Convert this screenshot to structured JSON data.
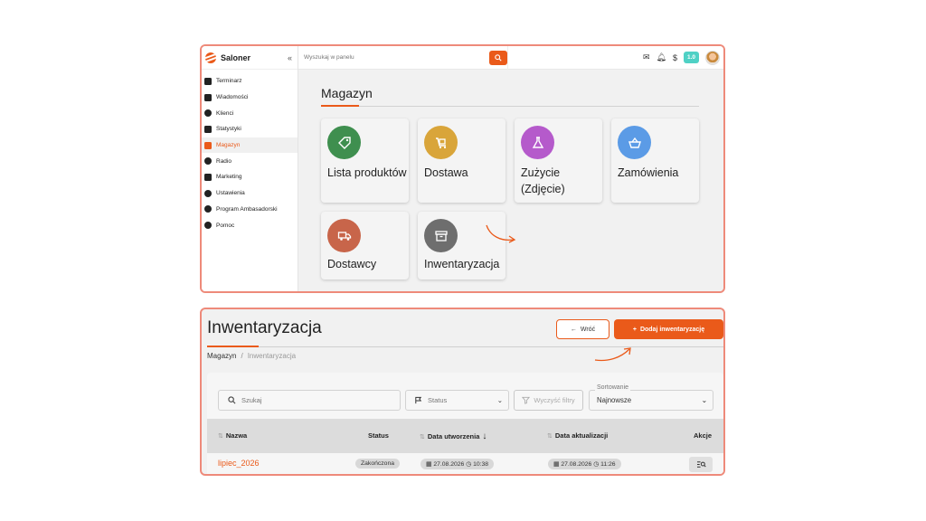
{
  "colors": {
    "accent": "#ea5a1a",
    "panel_border": "#ee8a7a",
    "badge": "#4fd1c5"
  },
  "app": {
    "name": "Saloner",
    "version": "1.0"
  },
  "sidebar": {
    "items": [
      {
        "label": "Terminarz",
        "icon": "calendar-icon"
      },
      {
        "label": "Wiadomości",
        "icon": "mail-icon"
      },
      {
        "label": "Klienci",
        "icon": "users-icon"
      },
      {
        "label": "Statystyki",
        "icon": "bar-chart-icon"
      },
      {
        "label": "Magazyn",
        "icon": "bag-icon",
        "active": true
      },
      {
        "label": "Radio",
        "icon": "music-icon"
      },
      {
        "label": "Marketing",
        "icon": "megaphone-icon"
      },
      {
        "label": "Ustawienia",
        "icon": "gear-icon"
      },
      {
        "label": "Program Ambasadorski",
        "icon": "smile-icon"
      },
      {
        "label": "Pomoc",
        "icon": "help-icon"
      }
    ]
  },
  "topbar": {
    "search_placeholder": "Wyszukaj w panelu"
  },
  "magazyn": {
    "title": "Magazyn",
    "cards": [
      {
        "label": "Lista produktów",
        "color": "#3f8f4f",
        "icon": "tag-icon"
      },
      {
        "label": "Dostawa",
        "color": "#d9a53a",
        "icon": "cart-icon"
      },
      {
        "label": "Zużycie (Zdjęcie)",
        "color": "#b55acb",
        "icon": "flask-icon"
      },
      {
        "label": "Zamówienia",
        "color": "#5b9be6",
        "icon": "basket-icon"
      },
      {
        "label": "Dostawcy",
        "color": "#c8654a",
        "icon": "truck-icon"
      },
      {
        "label": "Inwentaryzacja",
        "color": "#6e6e6e",
        "icon": "archive-icon"
      }
    ]
  },
  "inwentaryzacja": {
    "title": "Inwentaryzacja",
    "back_label": "Wróć",
    "add_label": "Dodaj inwentaryzację",
    "breadcrumb": {
      "parent": "Magazyn",
      "separator": "/",
      "current": "Inwentaryzacja"
    },
    "filters": {
      "search_placeholder": "Szukaj",
      "status_label": "Status",
      "clear_label": "Wyczyść filtry",
      "sort_legend": "Sortowanie",
      "sort_value": "Najnowsze"
    },
    "table": {
      "columns": [
        "Nazwa",
        "Status",
        "Data utworzenia",
        "Data aktualizacji",
        "Akcje"
      ],
      "rows": [
        {
          "name": "lipiec_2026",
          "status": "Zakończona",
          "created": "27.08.2026",
          "created_time": "10:38",
          "updated": "27.08.2026",
          "updated_time": "11:26"
        }
      ]
    }
  }
}
